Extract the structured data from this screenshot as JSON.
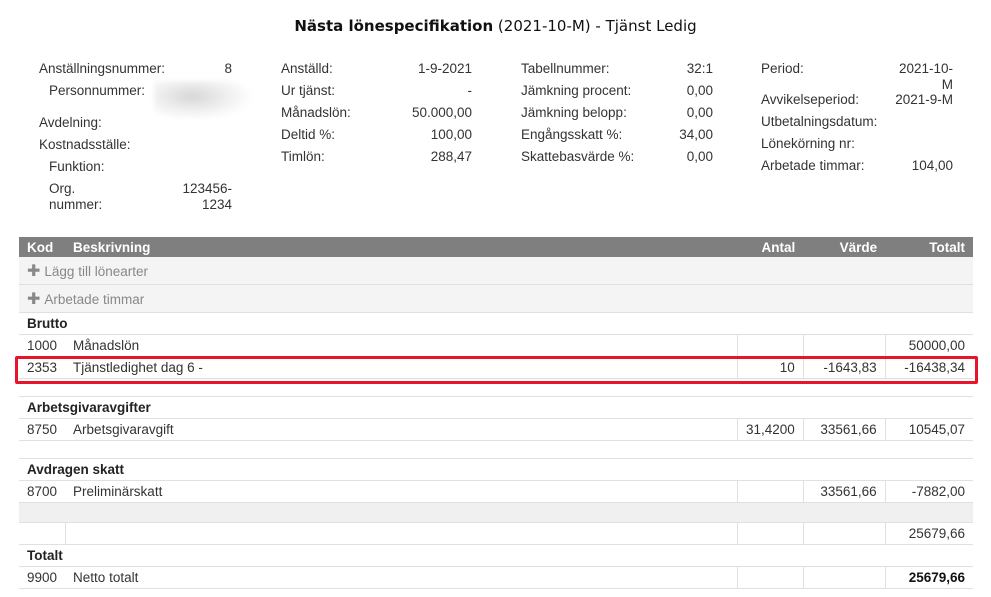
{
  "title_bold": "Nästa lönespecifikation",
  "title_rest": " (2021-10-M) - Tjänst Ledig",
  "info": {
    "col1": [
      {
        "label": "Anställningsnummer:",
        "value": "8"
      },
      {
        "label": "Personnummer:",
        "value": ""
      },
      {
        "label": "Avdelning:",
        "value": ""
      },
      {
        "label": "Kostnadsställe:",
        "value": ""
      },
      {
        "label": "Funktion:",
        "value": ""
      },
      {
        "label": "Org. nummer:",
        "value": "123456-1234"
      }
    ],
    "col2": [
      {
        "label": "Anställd:",
        "value": "1-9-2021"
      },
      {
        "label": "Ur tjänst:",
        "value": "-"
      },
      {
        "label": "Månadslön:",
        "value": "50.000,00"
      },
      {
        "label": "Deltid %:",
        "value": "100,00"
      },
      {
        "label": "Timlön:",
        "value": "288,47"
      }
    ],
    "col3": [
      {
        "label": "Tabellnummer:",
        "value": "32:1"
      },
      {
        "label": "Jämkning procent:",
        "value": "0,00"
      },
      {
        "label": "Jämkning belopp:",
        "value": "0,00"
      },
      {
        "label": "Engångsskatt %:",
        "value": "34,00"
      },
      {
        "label": "Skattebasvärde %:",
        "value": "0,00"
      }
    ],
    "col4": [
      {
        "label": "Period:",
        "value": "2021-10-M"
      },
      {
        "label": "Avvikelseperiod:",
        "value": "2021-9-M"
      },
      {
        "label": "Utbetalningsdatum:",
        "value": ""
      },
      {
        "label": "Lönekörning nr:",
        "value": ""
      },
      {
        "label": "Arbetade timmar:",
        "value": "104,00"
      }
    ]
  },
  "table": {
    "headers": {
      "kod": "Kod",
      "beskrivning": "Beskrivning",
      "antal": "Antal",
      "varde": "Värde",
      "totalt": "Totalt"
    },
    "add_lonearter": "Lägg till lönearter",
    "arbetade_timmar": "Arbetade timmar",
    "brutto": {
      "title": "Brutto",
      "rows": [
        {
          "kod": "1000",
          "beskrivning": "Månadslön",
          "antal": "",
          "varde": "",
          "totalt": "50000,00"
        },
        {
          "kod": "2353",
          "beskrivning": "Tjänstledighet dag 6 -",
          "antal": "10",
          "varde": "-1643,83",
          "totalt": "-16438,34"
        }
      ]
    },
    "arbetsgivaravgifter": {
      "title": "Arbetsgivaravgifter",
      "rows": [
        {
          "kod": "8750",
          "beskrivning": "Arbetsgivaravgift",
          "antal": "31,4200",
          "varde": "33561,66",
          "totalt": "10545,07"
        }
      ]
    },
    "skatt": {
      "title": "Avdragen skatt",
      "rows": [
        {
          "kod": "8700",
          "beskrivning": "Preliminärskatt",
          "antal": "",
          "varde": "33561,66",
          "totalt": "-7882,00"
        }
      ]
    },
    "subtotal": "25679,66",
    "totalt": {
      "title": "Totalt",
      "row": {
        "kod": "9900",
        "beskrivning": "Netto totalt",
        "totalt": "25679,66"
      }
    }
  },
  "colors": {
    "header_bg": "#7f7f7f",
    "highlight": "#e8142a"
  }
}
